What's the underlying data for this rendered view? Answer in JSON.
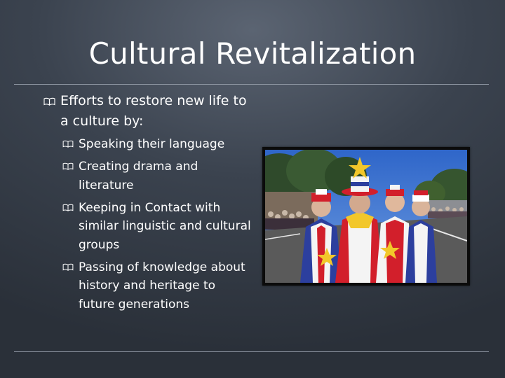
{
  "slide": {
    "title": "Cultural Revitalization",
    "main_bullet": "Efforts to restore new life to a culture by:",
    "sub_bullets": [
      "Speaking their language",
      "Creating drama and literature",
      "Keeping in Contact with similar linguistic and cultural groups",
      "Passing of knowledge about history and heritage to future generations"
    ]
  },
  "icons": {
    "bullet": "book-icon",
    "photo": "festival-costumed-performers-photo"
  },
  "colors": {
    "background_center": "#5b6472",
    "background_edge": "#2a3039",
    "text": "#ffffff",
    "rule": "#8e96a2"
  }
}
